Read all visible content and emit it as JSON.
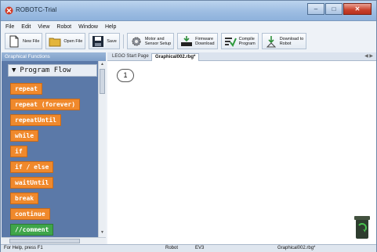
{
  "window": {
    "title": "ROBOTC-Trial"
  },
  "menu": [
    "File",
    "Edit",
    "View",
    "Robot",
    "Window",
    "Help"
  ],
  "toolbar": {
    "new_file": "New File",
    "open_file": "Open File",
    "save": "Save",
    "motor_setup_1": "Motor and",
    "motor_setup_2": "Sensor Setup",
    "firmware_1": "Firmware",
    "firmware_2": "Download",
    "compile_1": "Compile",
    "compile_2": "Program",
    "download_1": "Download to",
    "download_2": "Robot"
  },
  "functions_panel": {
    "title": "Graphical Functions",
    "category": "Program Flow",
    "blocks": [
      {
        "label": "repeat",
        "color": "#f0892c"
      },
      {
        "label": "repeat (forever)",
        "color": "#f0892c"
      },
      {
        "label": "repeatUntil",
        "color": "#f0892c"
      },
      {
        "label": "while",
        "color": "#f0892c"
      },
      {
        "label": "if",
        "color": "#f0892c"
      },
      {
        "label": "if / else",
        "color": "#f0892c"
      },
      {
        "label": "waitUntil",
        "color": "#f0892c"
      },
      {
        "label": "break",
        "color": "#f0892c"
      },
      {
        "label": "continue",
        "color": "#f0892c"
      },
      {
        "label": "//comment",
        "color": "#3fa64a"
      }
    ]
  },
  "tabs": [
    {
      "label": "LEGO Start Page",
      "active": false
    },
    {
      "label": "Graphical002.rbg*",
      "active": true
    }
  ],
  "editor": {
    "line_number": "1"
  },
  "status": {
    "help": "For Help, press F1",
    "target": "Robot",
    "platform": "EV3",
    "file": "Graphical002.rbg*"
  }
}
